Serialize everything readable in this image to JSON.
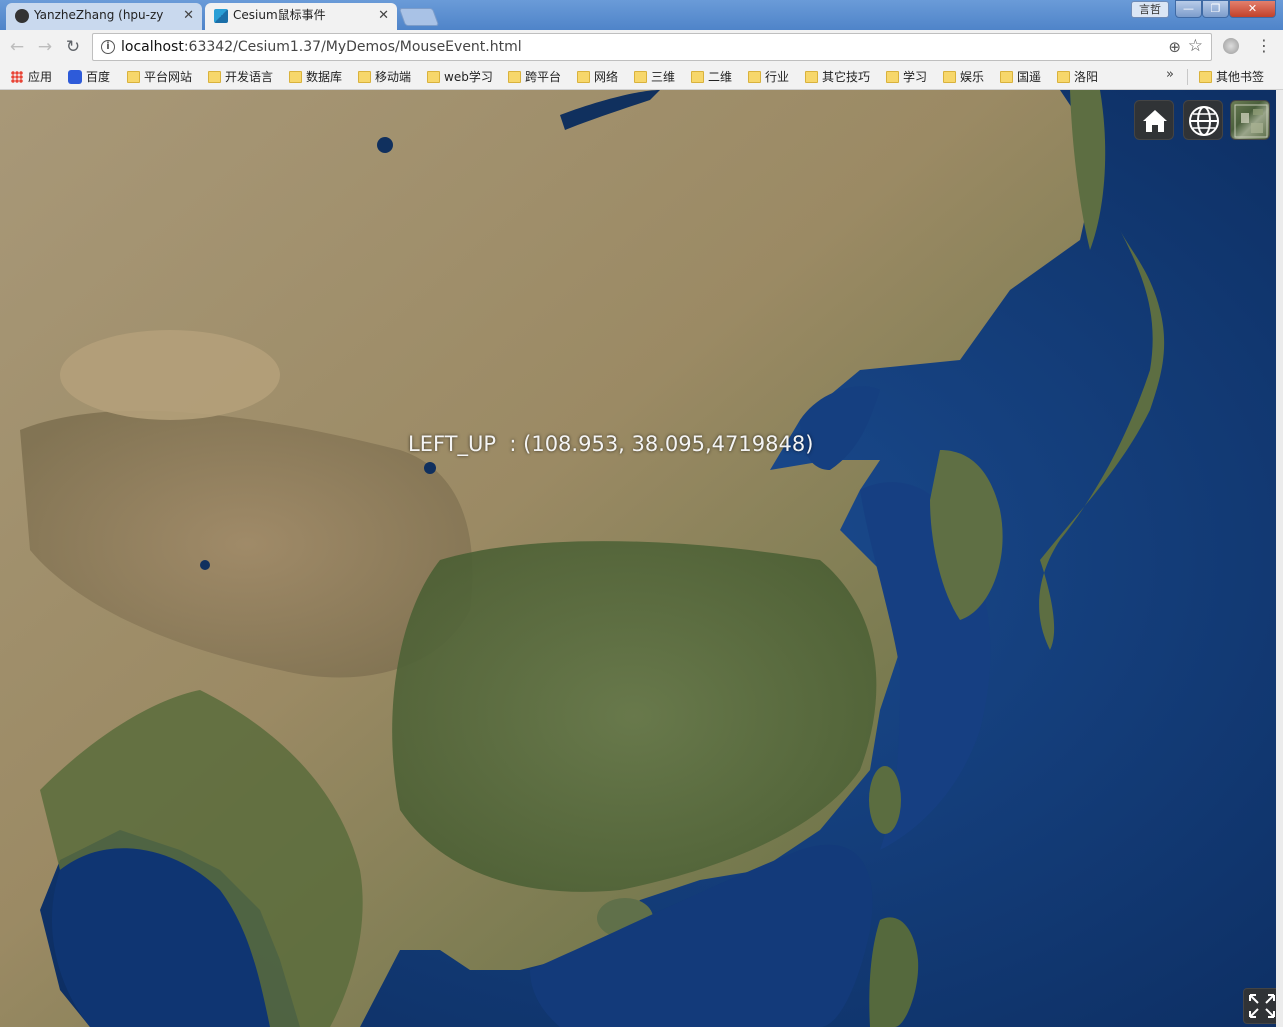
{
  "browser": {
    "tabs": [
      {
        "title": "YanzheZhang (hpu-zy",
        "icon": "github-icon"
      },
      {
        "title": "Cesium鼠标事件",
        "icon": "cesium-icon"
      }
    ],
    "close_glyph": "✕",
    "user_badge": "言哲",
    "window_controls": {
      "minimize": "—",
      "maximize": "❐",
      "close": "✕"
    }
  },
  "toolbar": {
    "url_host": "localhost",
    "url_rest": ":63342/Cesium1.37/MyDemos/MouseEvent.html",
    "back_glyph": "←",
    "forward_glyph": "→",
    "reload_glyph": "↻",
    "info_glyph": "i",
    "zoom_glyph": "⊕",
    "star_glyph": "☆",
    "menu_glyph": "⋮"
  },
  "bookmarks": {
    "items": [
      "应用",
      "百度",
      "平台网站",
      "开发语言",
      "数据库",
      "移动端",
      "web学习",
      "跨平台",
      "网络",
      "三维",
      "二维",
      "行业",
      "其它技巧",
      "学习",
      "娱乐",
      "国遥",
      "洛阳"
    ],
    "more_glyph": "»",
    "other": "其他书签"
  },
  "viewer": {
    "coordinate_label": "LEFT_UP  : (108.953, 38.095,4719848)",
    "buttons": [
      "home-icon",
      "globe-icon",
      "base-layer-picker-icon",
      "fullscreen-icon"
    ],
    "colors": {
      "ocean": "#0d3a7a",
      "land_desert": "#b09a72",
      "land_forest": "#5b6f3e",
      "button_bg": "#303336"
    }
  }
}
